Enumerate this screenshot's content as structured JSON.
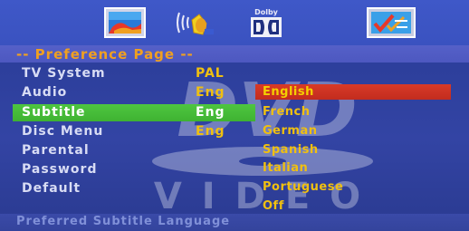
{
  "tabs": [
    {
      "name": "general-setup",
      "icon": "general-setup-icon"
    },
    {
      "name": "audio-setup",
      "icon": "speaker-icon"
    },
    {
      "name": "dolby-setup",
      "icon": "dolby-digital-icon",
      "label": "Dolby"
    },
    {
      "name": "preference",
      "icon": "preference-checklist-icon",
      "selected": true
    }
  ],
  "page_title": "-- Preference Page --",
  "watermark": {
    "logo": "DVD",
    "text": "VIDEO"
  },
  "menu": [
    {
      "label": "TV System",
      "value": "PAL"
    },
    {
      "label": "Audio",
      "value": "Eng"
    },
    {
      "label": "Subtitle",
      "value": "Eng",
      "selected": true
    },
    {
      "label": "Disc Menu",
      "value": "Eng"
    },
    {
      "label": "Parental",
      "value": ""
    },
    {
      "label": "Password",
      "value": ""
    },
    {
      "label": "Default",
      "value": ""
    }
  ],
  "options": [
    "English",
    "French",
    "German",
    "Spanish",
    "Italian",
    "Portuguese",
    "Off"
  ],
  "highlighted_option": "English",
  "status": "Preferred Subtitle Language",
  "colors": {
    "background": "#2d3f9c",
    "top_bar": "#3f58c8",
    "title_text": "#f0a020",
    "value_text": "#f0c010",
    "selection_green": "#4ec640",
    "option_highlight_red": "#d83a28"
  }
}
